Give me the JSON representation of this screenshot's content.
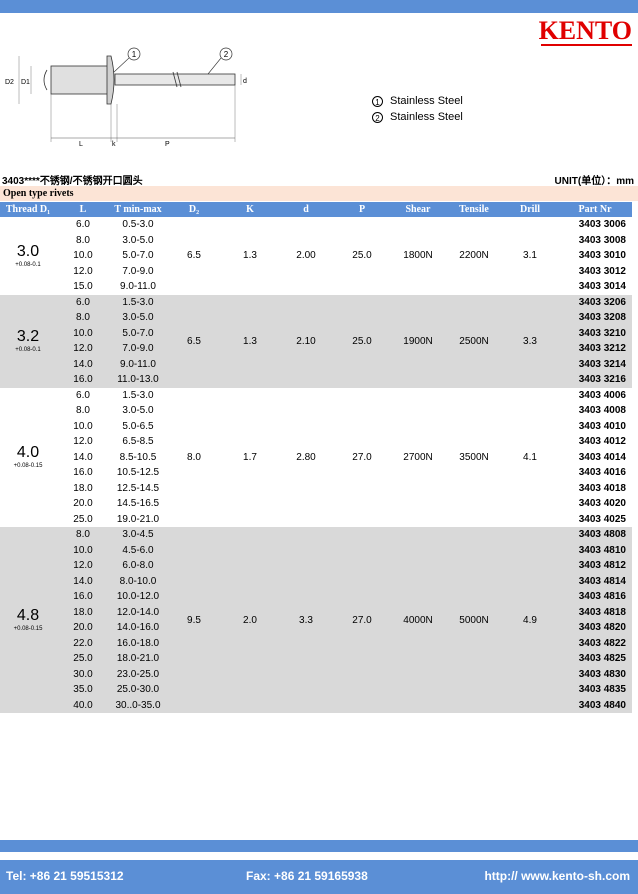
{
  "header": {
    "logo": "KENTO"
  },
  "drawing": {
    "labels": {
      "c1": "1",
      "c2": "2",
      "d2": "D2",
      "d1": "D1",
      "d": "d",
      "l": "L",
      "k": "k",
      "p": "P"
    }
  },
  "materials": [
    {
      "num": "1",
      "label": "Stainless Steel"
    },
    {
      "num": "2",
      "label": "Stainless Steel"
    }
  ],
  "product_title": "3403****不锈钢/不锈钢开口圆头",
  "unit": "UNIT(单位）：mm",
  "section": "Open type rivets",
  "columns": [
    "Thread D₁",
    "L",
    "T min-max",
    "D₂",
    "K",
    "d",
    "P",
    "Shear",
    "Tensile",
    "Drill",
    "Part Nr"
  ],
  "groups": [
    {
      "d1": "3.0",
      "tol": "+0.08-0.1",
      "d2": "6.5",
      "k": "1.3",
      "d": "2.00",
      "p": "25.0",
      "shear": "1800N",
      "tensile": "2200N",
      "drill": "3.1",
      "shade": false,
      "rows": [
        [
          "6.0",
          "0.5-3.0",
          "3403 3006"
        ],
        [
          "8.0",
          "3.0-5.0",
          "3403 3008"
        ],
        [
          "10.0",
          "5.0-7.0",
          "3403 3010"
        ],
        [
          "12.0",
          "7.0-9.0",
          "3403 3012"
        ],
        [
          "15.0",
          "9.0-11.0",
          "3403 3014"
        ]
      ]
    },
    {
      "d1": "3.2",
      "tol": "+0.08-0.1",
      "d2": "6.5",
      "k": "1.3",
      "d": "2.10",
      "p": "25.0",
      "shear": "1900N",
      "tensile": "2500N",
      "drill": "3.3",
      "shade": true,
      "rows": [
        [
          "6.0",
          "1.5-3.0",
          "3403 3206"
        ],
        [
          "8.0",
          "3.0-5.0",
          "3403 3208"
        ],
        [
          "10.0",
          "5.0-7.0",
          "3403 3210"
        ],
        [
          "12.0",
          "7.0-9.0",
          "3403 3212"
        ],
        [
          "14.0",
          "9.0-11.0",
          "3403 3214"
        ],
        [
          "16.0",
          "11.0-13.0",
          "3403 3216"
        ]
      ]
    },
    {
      "d1": "4.0",
      "tol": "+0.08-0.15",
      "d2": "8.0",
      "k": "1.7",
      "d": "2.80",
      "p": "27.0",
      "shear": "2700N",
      "tensile": "3500N",
      "drill": "4.1",
      "shade": false,
      "rows": [
        [
          "6.0",
          "1.5-3.0",
          "3403 4006"
        ],
        [
          "8.0",
          "3.0-5.0",
          "3403 4008"
        ],
        [
          "10.0",
          "5.0-6.5",
          "3403 4010"
        ],
        [
          "12.0",
          "6.5-8.5",
          "3403 4012"
        ],
        [
          "14.0",
          "8.5-10.5",
          "3403 4014"
        ],
        [
          "16.0",
          "10.5-12.5",
          "3403 4016"
        ],
        [
          "18.0",
          "12.5-14.5",
          "3403 4018"
        ],
        [
          "20.0",
          "14.5-16.5",
          "3403 4020"
        ],
        [
          "25.0",
          "19.0-21.0",
          "3403 4025"
        ]
      ]
    },
    {
      "d1": "4.8",
      "tol": "+0.08-0.15",
      "d2": "9.5",
      "k": "2.0",
      "d": "3.3",
      "p": "27.0",
      "shear": "4000N",
      "tensile": "5000N",
      "drill": "4.9",
      "shade": true,
      "rows": [
        [
          "8.0",
          "3.0-4.5",
          "3403 4808"
        ],
        [
          "10.0",
          "4.5-6.0",
          "3403 4810"
        ],
        [
          "12.0",
          "6.0-8.0",
          "3403 4812"
        ],
        [
          "14.0",
          "8.0-10.0",
          "3403 4814"
        ],
        [
          "16.0",
          "10.0-12.0",
          "3403 4816"
        ],
        [
          "18.0",
          "12.0-14.0",
          "3403 4818"
        ],
        [
          "20.0",
          "14.0-16.0",
          "3403 4820"
        ],
        [
          "22.0",
          "16.0-18.0",
          "3403 4822"
        ],
        [
          "25.0",
          "18.0-21.0",
          "3403 4825"
        ],
        [
          "30.0",
          "23.0-25.0",
          "3403 4830"
        ],
        [
          "35.0",
          "25.0-30.0",
          "3403 4835"
        ],
        [
          "40.0",
          "30..0-35.0",
          "3403 4840"
        ]
      ]
    }
  ],
  "footer": {
    "tel": "Tel: +86 21 59515312",
    "fax": "Fax: +86 21 59165938",
    "web": "http:// www.kento-sh.com"
  },
  "colors": {
    "accent": "#5b8fd6",
    "logo": "#e00000",
    "section_bg": "#fce4d6",
    "shade": "#d9d9d9"
  }
}
